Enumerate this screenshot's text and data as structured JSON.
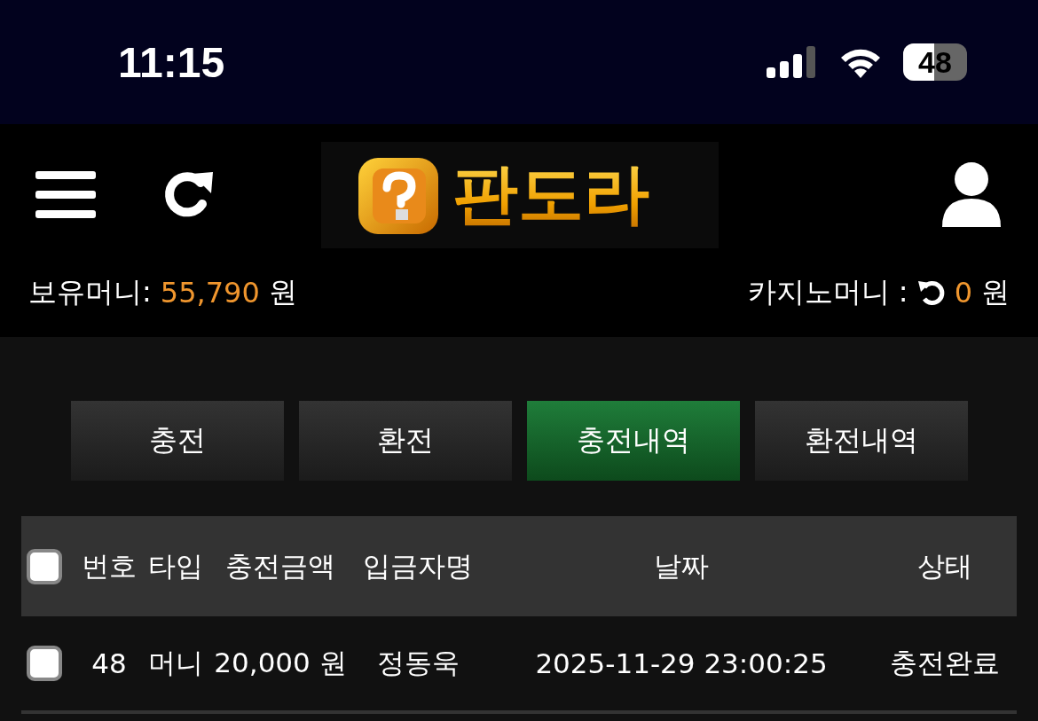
{
  "status_bar": {
    "time": "11:15",
    "battery": "48"
  },
  "header": {
    "logo_text": "판도라"
  },
  "balance": {
    "label": "보유머니:",
    "amount": "55,790",
    "unit": "원"
  },
  "casino": {
    "label": "카지노머니 :",
    "amount": "0",
    "unit": "원"
  },
  "tabs": [
    {
      "label": "충전",
      "selected": false
    },
    {
      "label": "환전",
      "selected": false
    },
    {
      "label": "충전내역",
      "selected": true
    },
    {
      "label": "환전내역",
      "selected": false
    }
  ],
  "table": {
    "select_all_checked": false,
    "columns": [
      "번호",
      "타입",
      "충전금액",
      "입금자명",
      "날짜",
      "상태"
    ],
    "rows": [
      {
        "checked": false,
        "cells": [
          "48",
          "머니",
          "20,000 원",
          "정동욱",
          "2025-11-29 23:00:25",
          "충전완료"
        ]
      }
    ]
  }
}
